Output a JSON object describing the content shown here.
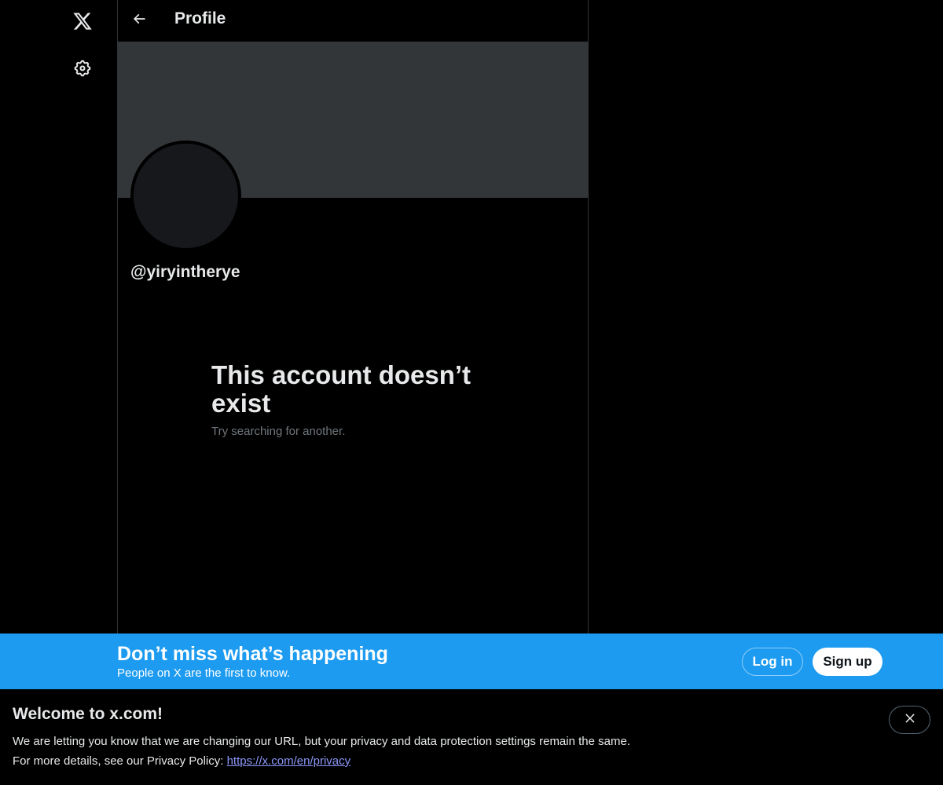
{
  "nav": {
    "logo_icon": "x-logo-icon",
    "settings_icon": "gear-icon"
  },
  "header": {
    "back_icon": "arrow-left-icon",
    "title": "Profile"
  },
  "profile": {
    "handle": "@yiryintherye",
    "banner_color": "#333639",
    "avatar_color": "#16181c"
  },
  "empty_state": {
    "title": "This account doesn’t exist",
    "subtitle": "Try searching for another."
  },
  "signup_bar": {
    "title": "Don’t miss what’s happening",
    "subtitle": "People on X are the first to know.",
    "login_label": "Log in",
    "signup_label": "Sign up",
    "background": "#1d9bf0"
  },
  "notice": {
    "title": "Welcome to x.com!",
    "line1": "We are letting you know that we are changing our URL, but your privacy and data protection settings remain the same.",
    "line2_prefix": "For more details, see our Privacy Policy: ",
    "link_text": "https://x.com/en/privacy",
    "close_icon": "close-icon"
  }
}
